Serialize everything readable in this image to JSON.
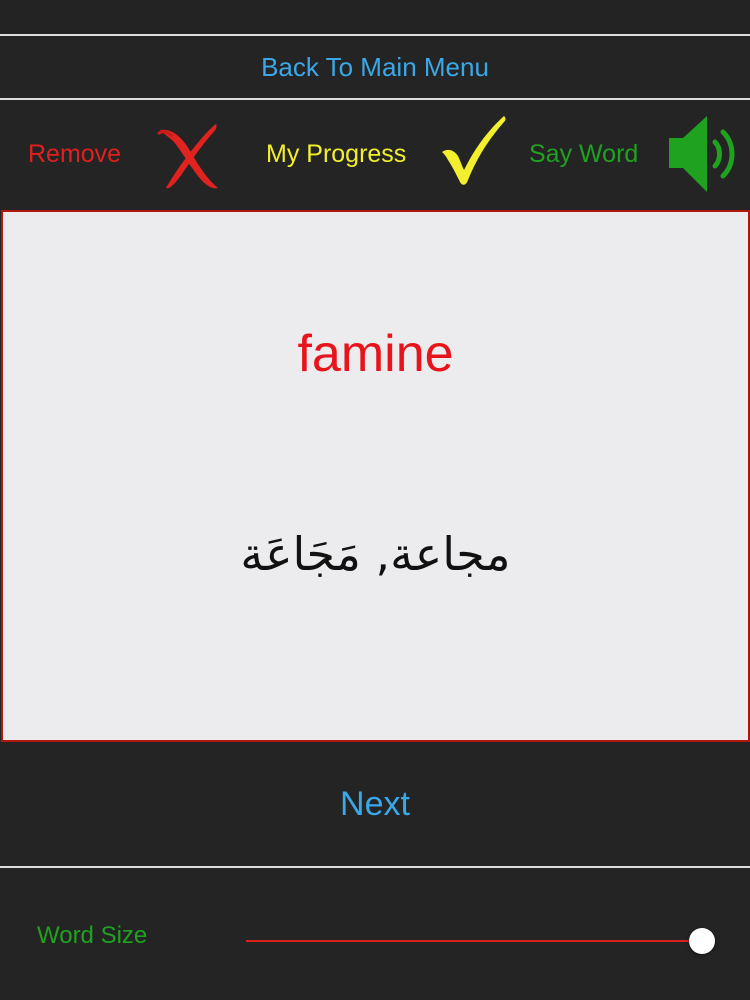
{
  "nav": {
    "back_label": "Back To Main Menu"
  },
  "toolbar": {
    "remove_label": "Remove",
    "progress_label": "My Progress",
    "say_word_label": "Say Word",
    "remove_icon": "red-x-icon",
    "progress_icon": "yellow-check-icon",
    "say_word_icon": "speaker-icon"
  },
  "card": {
    "word": "famine",
    "translation": "مجاعة,  مَجَاعَة"
  },
  "footer": {
    "next_label": "Next",
    "word_size_label": "Word Size",
    "word_size_value": 1.0
  },
  "colors": {
    "background": "#242424",
    "link_blue": "#3aa8e8",
    "remove_red": "#e02020",
    "progress_yellow": "#f2ef2e",
    "say_green": "#1fa21f",
    "card_border": "#b0170f",
    "word_red": "#e8141c"
  }
}
